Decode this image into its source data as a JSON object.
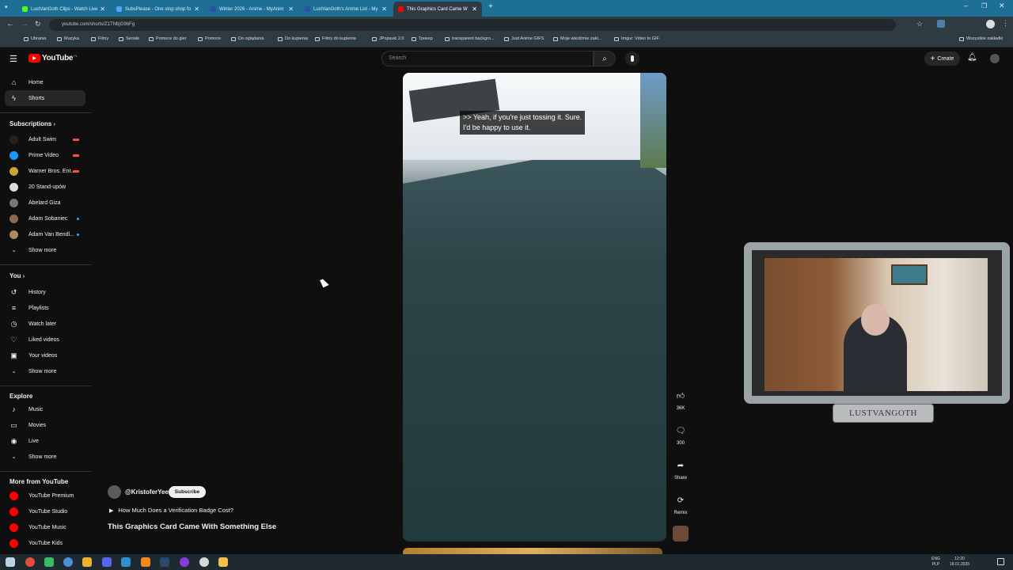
{
  "browser": {
    "tabs": [
      {
        "title": "LustVanGoth Clips - Watch Live",
        "color": "#53fc18",
        "active": false
      },
      {
        "title": "SubsPlease - One stop shop fo",
        "color": "#4da6ff",
        "active": false
      },
      {
        "title": "Winter 2026 - Anime - MyAnim",
        "color": "#2e51a2",
        "active": false
      },
      {
        "title": "LustVanGoth's Anime List - My",
        "color": "#2e51a2",
        "active": false
      },
      {
        "title": "This Graphics Card Came W",
        "color": "#ff0000",
        "active": true
      }
    ],
    "url": "youtube.com/shorts/Z1TNbjG9bFg",
    "bookmarks": [
      "Ubrania",
      "Muzyka",
      "Filmy",
      "Seriale",
      "Pomoce do gier",
      "Pomoce",
      "Do oglądania",
      "Do kupienia",
      "Filmy do kupienia",
      "JPopsuki 2.0",
      "Трекер",
      "transparent backgro...",
      "Just Anime GIFS",
      "Moje wiedźmie zakl...",
      "Imgur: Video to GIF"
    ],
    "bookmarks_right": "Wszystkie zakładki"
  },
  "youtube": {
    "logo": "YouTube",
    "logo_region": "PL",
    "search_placeholder": "Search",
    "create_label": "Create",
    "nav": [
      {
        "label": "Home",
        "icon": "home-icon"
      },
      {
        "label": "Shorts",
        "icon": "shorts-icon"
      }
    ],
    "subscriptions_header": "Subscriptions",
    "subscriptions": [
      {
        "label": "Adult Swim",
        "live": true,
        "color": "#222222"
      },
      {
        "label": "Prime Video",
        "live": true,
        "color": "#1a98ff"
      },
      {
        "label": "Warner Bros. Ent...",
        "live": true,
        "color": "#c9a43b"
      },
      {
        "label": "20 Stand-upów",
        "live": false,
        "color": "#dddddd"
      },
      {
        "label": "Abelard Giza",
        "live": false,
        "color": "#777777"
      },
      {
        "label": "Adam Sobaniec",
        "live": false,
        "dot": true,
        "color": "#8a6b4e"
      },
      {
        "label": "Adam Van Bendl...",
        "live": false,
        "dot": true,
        "color": "#b08a5a"
      }
    ],
    "show_more": "Show more",
    "you_header": "You",
    "you_items": [
      {
        "label": "History",
        "icon": "history-icon"
      },
      {
        "label": "Playlists",
        "icon": "playlists-icon"
      },
      {
        "label": "Watch later",
        "icon": "watch-later-icon"
      },
      {
        "label": "Liked videos",
        "icon": "liked-videos-icon"
      },
      {
        "label": "Your videos",
        "icon": "your-videos-icon"
      }
    ],
    "explore_header": "Explore",
    "explore_items": [
      {
        "label": "Music",
        "icon": "music-icon"
      },
      {
        "label": "Movies",
        "icon": "movies-icon"
      },
      {
        "label": "Live",
        "icon": "live-icon"
      }
    ],
    "more_header": "More from YouTube",
    "more_items": [
      "YouTube Premium",
      "YouTube Studio",
      "YouTube Music",
      "YouTube Kids"
    ],
    "short": {
      "caption_line1": ">> Yeah, if you're just tossing it. Sure.",
      "caption_line2": "I'd be happy to use it.",
      "channel": "@KristoferYee",
      "subscribe": "Subscribe",
      "playlist_title": "How Much Does a Verification Badge Cost?",
      "title": "This Graphics Card Came With Something Else",
      "likes": "36K",
      "comments": "300",
      "share": "Share",
      "remix": "Remix"
    },
    "streamer_name": "LUSTVANGOTH"
  },
  "taskbar": {
    "lang": "ENG",
    "lang2": "PLP",
    "time": "12:20",
    "date": "18.01.2026"
  }
}
